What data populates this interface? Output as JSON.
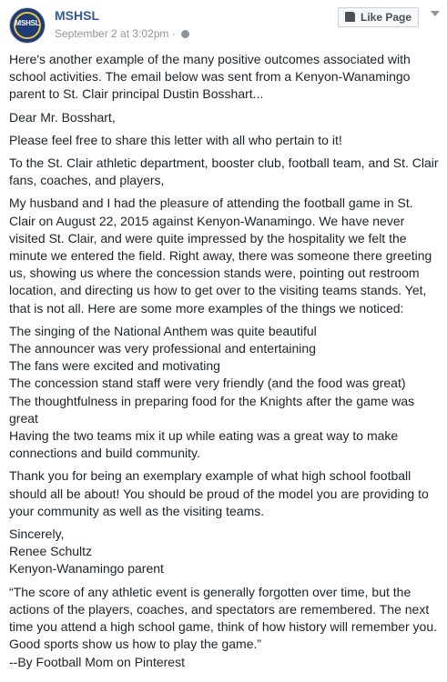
{
  "header": {
    "avatar_text": "MSHSL",
    "page_name": "MSHSL",
    "timestamp": "September 2 at 3:02pm",
    "separator": " · ",
    "globe_icon": "globe-icon",
    "like_button_label": "Like Page"
  },
  "post": {
    "intro": "Here's another example of the many positive outcomes associated with school activities. The email below was sent from a Kenyon-Wanamingo parent to St. Clair principal Dustin Bosshart...",
    "salutation": "Dear Mr. Bosshart,",
    "share_line": "Please feel free to share this letter with all who pertain to it!",
    "address_line": "To the St. Clair athletic department, booster club, football team, and St. Clair fans, coaches, and players,",
    "body_paragraph": "My husband and I had the pleasure of attending the football game in St. Clair on August 22, 2015 against Kenyon-Wanamingo. We have never visited St. Clair, and were quite impressed by the hospitality we felt the minute we entered the field. Right away, there was someone there greeting us, showing us where the concession stands were, pointing out restroom location, and directing us how to get over to the visiting teams stands. Yet, that is not all. Here are some more examples of the things we noticed:",
    "observations": [
      "The singing of the National Anthem was quite beautiful",
      "The announcer was very professional and entertaining",
      "The fans were excited and motivating",
      "The concession stand staff were very friendly (and the food was great)",
      "The thoughtfulness in preparing food for the Knights after the game was great",
      "Having the two teams mix it up while eating was a great way to make connections and build community."
    ],
    "thanks_paragraph": "Thank you for being an exemplary example of what high school football should all be about! You should be proud of the model you are providing to your community as well as the visiting teams.",
    "signoff": [
      "Sincerely,",
      "Renee Schultz",
      "Kenyon-Wanamingo parent"
    ],
    "quote": "“The score of any athletic event is generally forgotten over time, but the actions of the players, coaches, and spectators are remembered. The next time you attend a high school game, think of how history will remember you. Good sports show us how to play the game.”",
    "quote_attribution": "--By Football Mom on Pinterest"
  }
}
